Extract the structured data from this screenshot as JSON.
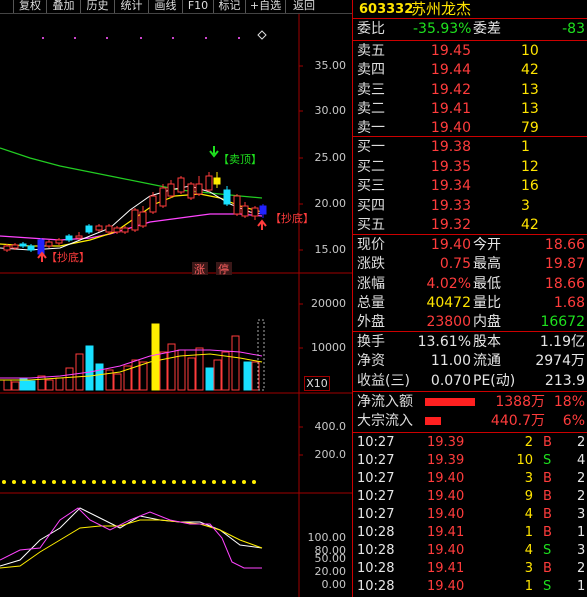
{
  "toolbar": [
    "复权",
    "叠加",
    "历史",
    "统计",
    "画线",
    "F10",
    "标记",
    "+自选",
    "返回"
  ],
  "stock": {
    "code": "603332",
    "name": "苏州龙杰"
  },
  "weibi": {
    "label": "委比",
    "value": "-35.93%",
    "label2": "委差",
    "value2": "-83"
  },
  "asks": [
    {
      "label": "卖五",
      "price": "19.45",
      "vol": "10"
    },
    {
      "label": "卖四",
      "price": "19.44",
      "vol": "42"
    },
    {
      "label": "卖三",
      "price": "19.42",
      "vol": "13"
    },
    {
      "label": "卖二",
      "price": "19.41",
      "vol": "13"
    },
    {
      "label": "卖一",
      "price": "19.40",
      "vol": "79"
    }
  ],
  "bids": [
    {
      "label": "买一",
      "price": "19.38",
      "vol": "1"
    },
    {
      "label": "买二",
      "price": "19.35",
      "vol": "12"
    },
    {
      "label": "买三",
      "price": "19.34",
      "vol": "16"
    },
    {
      "label": "买四",
      "price": "19.33",
      "vol": "3"
    },
    {
      "label": "买五",
      "price": "19.32",
      "vol": "42"
    }
  ],
  "quote": [
    {
      "l1": "现价",
      "v1": "19.40",
      "l2": "今开",
      "v2": "18.66"
    },
    {
      "l1": "涨跌",
      "v1": "0.75",
      "l2": "最高",
      "v2": "19.87"
    },
    {
      "l1": "涨幅",
      "v1": "4.02%",
      "l2": "最低",
      "v2": "18.66"
    },
    {
      "l1": "总量",
      "v1": "40472",
      "l2": "量比",
      "v2": "1.68"
    },
    {
      "l1": "外盘",
      "v1": "23800",
      "l2": "内盘",
      "v2": "16672"
    }
  ],
  "fin": [
    {
      "l1": "换手",
      "v1": "13.61%",
      "l2": "股本",
      "v2": "1.19亿"
    },
    {
      "l1": "净资",
      "v1": "11.00",
      "l2": "流通",
      "v2": "2974万"
    },
    {
      "l1": "收益(三)",
      "v1": "0.070",
      "l2": "PE(动)",
      "v2": "213.9"
    }
  ],
  "flow": [
    {
      "label": "净流入额",
      "value": "1388万",
      "pct": "18%",
      "bar": 0.8
    },
    {
      "label": "大宗流入",
      "value": "440.7万",
      "pct": "6%",
      "bar": 0.25
    }
  ],
  "trades": [
    {
      "t": "10:27",
      "p": "19.39",
      "v": "2",
      "d": "B",
      "n": "2"
    },
    {
      "t": "10:27",
      "p": "19.39",
      "v": "10",
      "d": "S",
      "n": "4"
    },
    {
      "t": "10:27",
      "p": "19.40",
      "v": "3",
      "d": "B",
      "n": "2"
    },
    {
      "t": "10:27",
      "p": "19.40",
      "v": "9",
      "d": "B",
      "n": "2"
    },
    {
      "t": "10:27",
      "p": "19.40",
      "v": "4",
      "d": "B",
      "n": "3"
    },
    {
      "t": "10:28",
      "p": "19.41",
      "v": "1",
      "d": "B",
      "n": "1"
    },
    {
      "t": "10:28",
      "p": "19.40",
      "v": "4",
      "d": "S",
      "n": "3"
    },
    {
      "t": "10:28",
      "p": "19.41",
      "v": "3",
      "d": "B",
      "n": "2"
    },
    {
      "t": "10:28",
      "p": "19.40",
      "v": "1",
      "d": "S",
      "n": "1"
    }
  ],
  "price_axis": [
    "35.00",
    "30.00",
    "25.00",
    "20.00",
    "15.00"
  ],
  "vol_axis": [
    "20000",
    "10000"
  ],
  "vol_unit": "X10",
  "ind1_axis": [
    "400.0",
    "200.0"
  ],
  "ind2_axis": [
    "100.00",
    "80.00",
    "50.00",
    "20.00",
    "0.00"
  ],
  "annotations": {
    "sell_top": "【卖顶】",
    "bottom1": "【抄底】",
    "bottom2": "【抄底】",
    "zhang": "涨",
    "ting": "停"
  },
  "colors": {
    "up": "#ff3c3c",
    "down": "#19e0ff",
    "ma5": "#ffffff",
    "ma10": "#ffee00",
    "ma20": "#ff44ff",
    "ma60": "#22cc22"
  }
}
